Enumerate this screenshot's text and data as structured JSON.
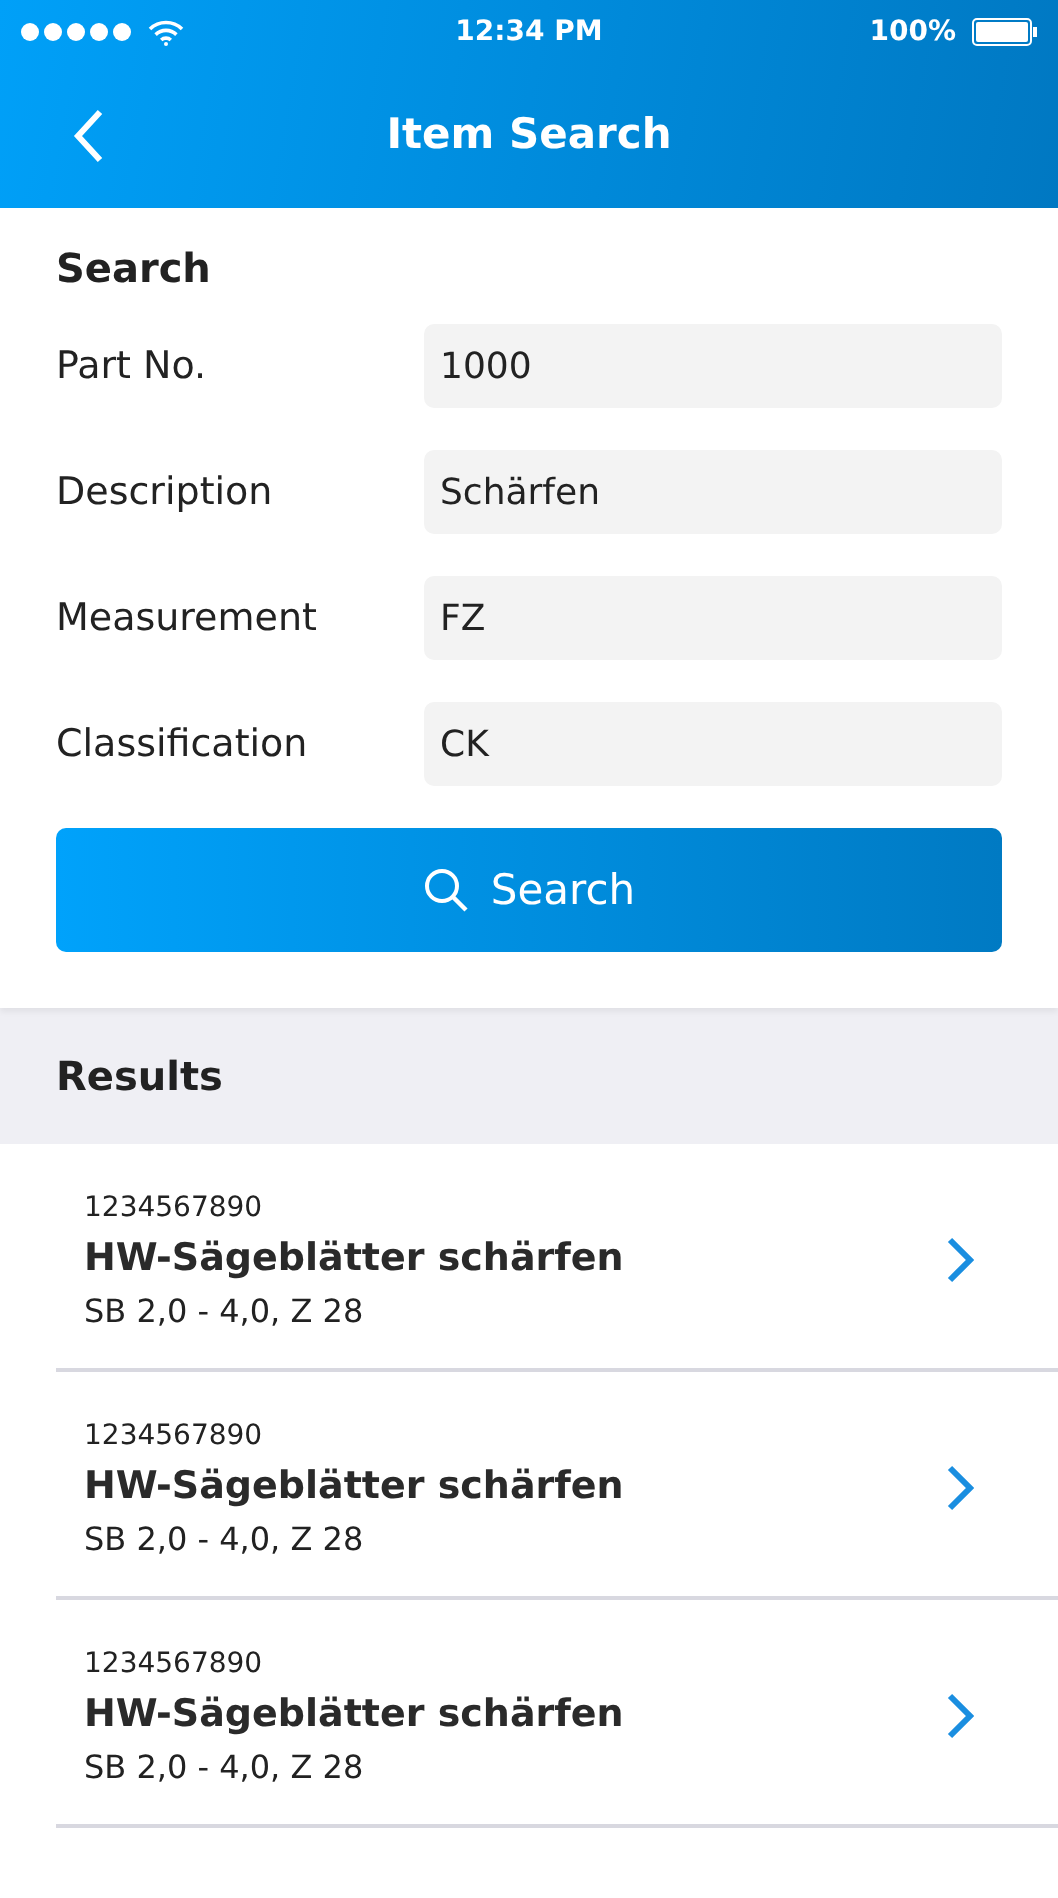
{
  "status_bar": {
    "time": "12:34 PM",
    "battery": "100%"
  },
  "header": {
    "title": "Item Search"
  },
  "search": {
    "heading": "Search",
    "fields": [
      {
        "label": "Part No.",
        "value": "1000"
      },
      {
        "label": "Description",
        "value": "Schärfen"
      },
      {
        "label": "Measurement",
        "value": "FZ"
      },
      {
        "label": "Classification",
        "value": "CK"
      }
    ],
    "button": "Search"
  },
  "results": {
    "heading": "Results",
    "items": [
      {
        "number": "1234567890",
        "title": "HW-Sägeblätter schärfen",
        "detail": "SB 2,0 - 4,0, Z 28"
      },
      {
        "number": "1234567890",
        "title": "HW-Sägeblätter schärfen",
        "detail": "SB 2,0 - 4,0, Z 28"
      },
      {
        "number": "1234567890",
        "title": "HW-Sägeblätter schärfen",
        "detail": "SB 2,0 - 4,0, Z 28"
      }
    ]
  }
}
